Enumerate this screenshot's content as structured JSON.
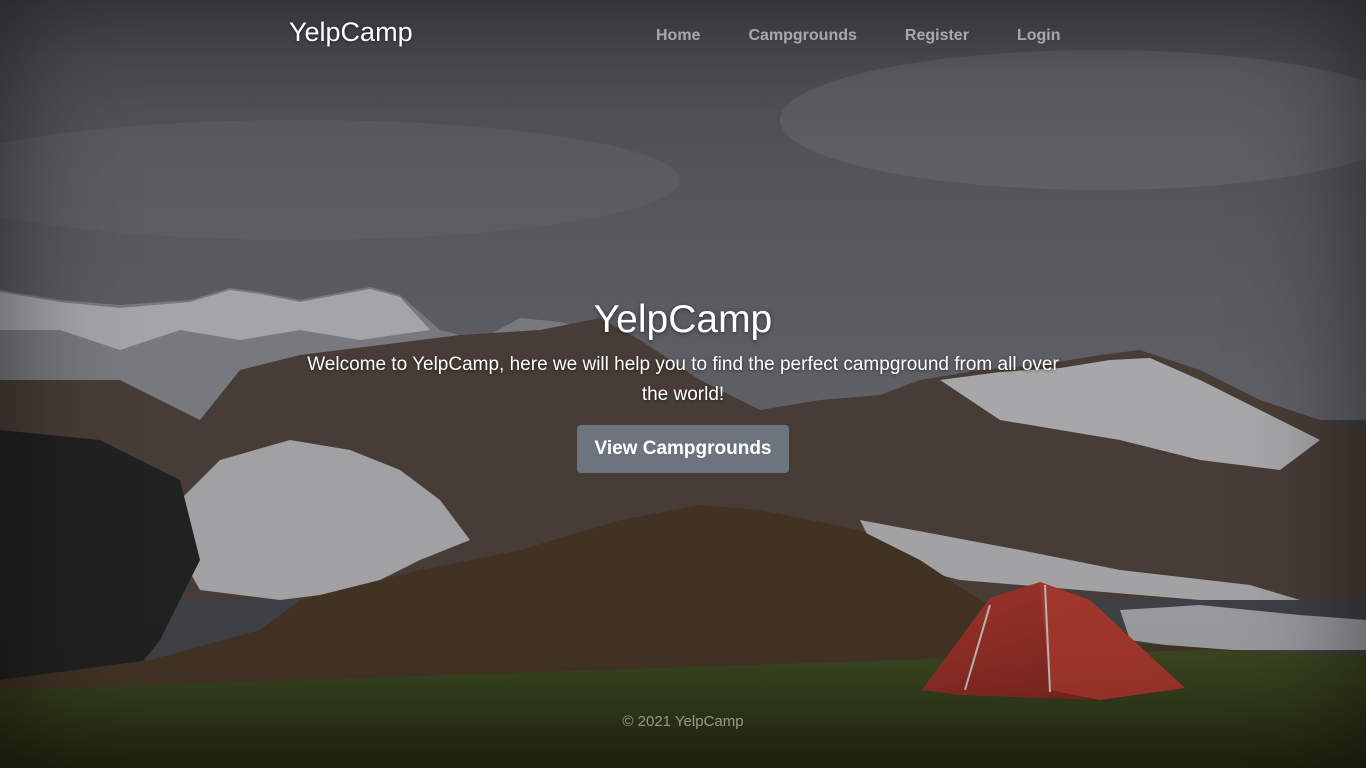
{
  "navbar": {
    "brand": "YelpCamp",
    "links": [
      {
        "label": "Home"
      },
      {
        "label": "Campgrounds"
      },
      {
        "label": "Register"
      },
      {
        "label": "Login"
      }
    ]
  },
  "hero": {
    "title": "YelpCamp",
    "lead": "Welcome to YelpCamp, here we will help you to find the perfect campground from all over the world!",
    "button_label": "View Campgrounds"
  },
  "footer": {
    "copyright": "© 2021 YelpCamp"
  },
  "background": {
    "description_icon": "mountain-landscape-with-tent-image",
    "colors": {
      "sky": "#5a5d63",
      "snow": "#d9d9dc",
      "rock": "#5e4f45",
      "grass": "#3c4a22",
      "tent": "#b8392c",
      "button": "#6c757d"
    }
  }
}
